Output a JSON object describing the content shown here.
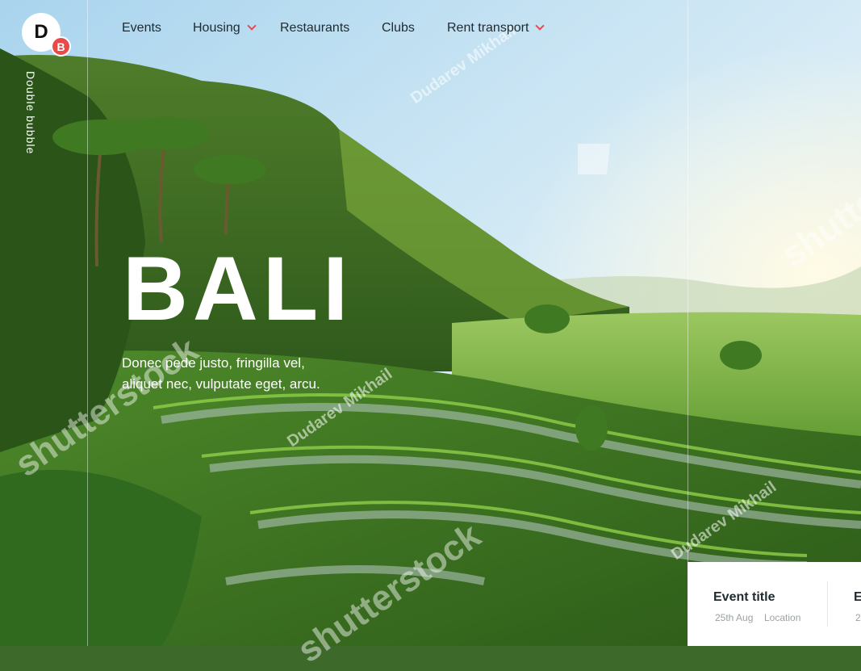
{
  "brand": {
    "logo_letter": "D",
    "badge_letter": "B",
    "name": "Double bubble"
  },
  "nav": {
    "items": [
      {
        "label": "Events",
        "has_dropdown": false
      },
      {
        "label": "Housing",
        "has_dropdown": true
      },
      {
        "label": "Restaurants",
        "has_dropdown": false
      },
      {
        "label": "Clubs",
        "has_dropdown": false
      },
      {
        "label": "Rent transport",
        "has_dropdown": true
      }
    ]
  },
  "hero": {
    "title": "BALI",
    "subtitle_line1": "Donec pede justo, fringilla vel,",
    "subtitle_line2": "aliquet nec, vulputate eget, arcu."
  },
  "events": [
    {
      "title": "Event title",
      "date": "25th Aug",
      "location": "Location"
    },
    {
      "title": "E",
      "date": "2"
    }
  ],
  "watermark": {
    "brand": "shutterstock",
    "author": "Dudarev Mikhail"
  },
  "colors": {
    "accent": "#e84a4a",
    "nav_text": "#1e2a30",
    "muted": "#9aa2a6"
  }
}
